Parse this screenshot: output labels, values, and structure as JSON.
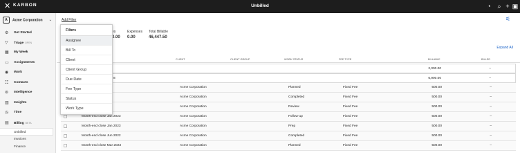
{
  "topbar": {
    "close_icon": "close-icon",
    "brand": "KARBON",
    "title": "Unbilled",
    "icons": [
      "help-icon",
      "search-icon",
      "plus-icon",
      "calendar-icon"
    ]
  },
  "org": {
    "initial": "A",
    "name": "Acme Corporation"
  },
  "nav": [
    {
      "label": "Get Started",
      "icon": "gear-icon"
    },
    {
      "label": "Triage",
      "tag": "OPEN",
      "icon": "filter-icon"
    },
    {
      "label": "My Week",
      "icon": "calendar-icon"
    },
    {
      "label": "Assignments",
      "icon": "inbox-icon"
    },
    {
      "label": "Work",
      "icon": "briefcase-icon"
    },
    {
      "label": "Contacts",
      "icon": "contacts-icon"
    },
    {
      "label": "Intelligence",
      "icon": "bulb-icon"
    },
    {
      "label": "Insights",
      "icon": "chart-icon"
    },
    {
      "label": "Time",
      "icon": "clock-icon"
    },
    {
      "label": "Billing",
      "tag": "BETA",
      "icon": "billing-icon"
    }
  ],
  "billing_sub": [
    "Unbilled",
    "Invoices",
    "Finance"
  ],
  "main": {
    "add_filter": "Add Filter",
    "summary": [
      {
        "label": "es",
        "value": "0.00"
      },
      {
        "label": "Expenses",
        "value": "0.00"
      },
      {
        "label": "Total Billable",
        "value": "46,447.50"
      }
    ],
    "expand_all": "Expand All",
    "headers": {
      "client": "CLIENT",
      "client_group": "CLIENT GROUP",
      "work_status": "WORK STATUS",
      "fee_type": "FEE TYPE",
      "billable": "BILLABLE",
      "billed": "BILLED"
    },
    "groups": [
      {
        "name": "",
        "billable": "2,000.00",
        "billed": "–"
      },
      {
        "name": "8",
        "billable": "6,900.00",
        "billed": "–"
      }
    ],
    "rows": [
      {
        "work": "23",
        "client": "Acme Corporation",
        "status": "Planned",
        "fee": "Fixed Fee",
        "billable": "500.00",
        "billed": "–"
      },
      {
        "work": "22",
        "client": "Acme Corporation",
        "status": "Completed",
        "fee": "Fixed Fee",
        "billable": "500.00",
        "billed": "–"
      },
      {
        "work": "23",
        "client": "Acme Corporation",
        "status": "Review",
        "fee": "Fixed Fee",
        "billable": "500.00",
        "billed": "–"
      },
      {
        "work": "Month-end close Jan 2023",
        "client": "Acme Corporation",
        "status": "Follow-up",
        "fee": "Fixed Fee",
        "billable": "500.00",
        "billed": "–"
      },
      {
        "work": "Month-end close Jan 2023",
        "client": "Acme Corporation",
        "status": "Prep",
        "fee": "Fixed Fee",
        "billable": "500.00",
        "billed": "–"
      },
      {
        "work": "Month-end close Jun 2022",
        "client": "Acme Corporation",
        "status": "Completed",
        "fee": "Fixed Fee",
        "billable": "500.00",
        "billed": "–"
      },
      {
        "work": "Month-end close Mar 2023",
        "client": "Acme Corporation",
        "status": "Planned",
        "fee": "Fixed Fee",
        "billable": "500.00",
        "billed": "–"
      }
    ]
  },
  "filters": {
    "header": "Filters",
    "items": [
      "Assignee",
      "Bill To",
      "Client",
      "Client Group",
      "Due Date",
      "Fee Type",
      "Status",
      "Work Type"
    ]
  }
}
